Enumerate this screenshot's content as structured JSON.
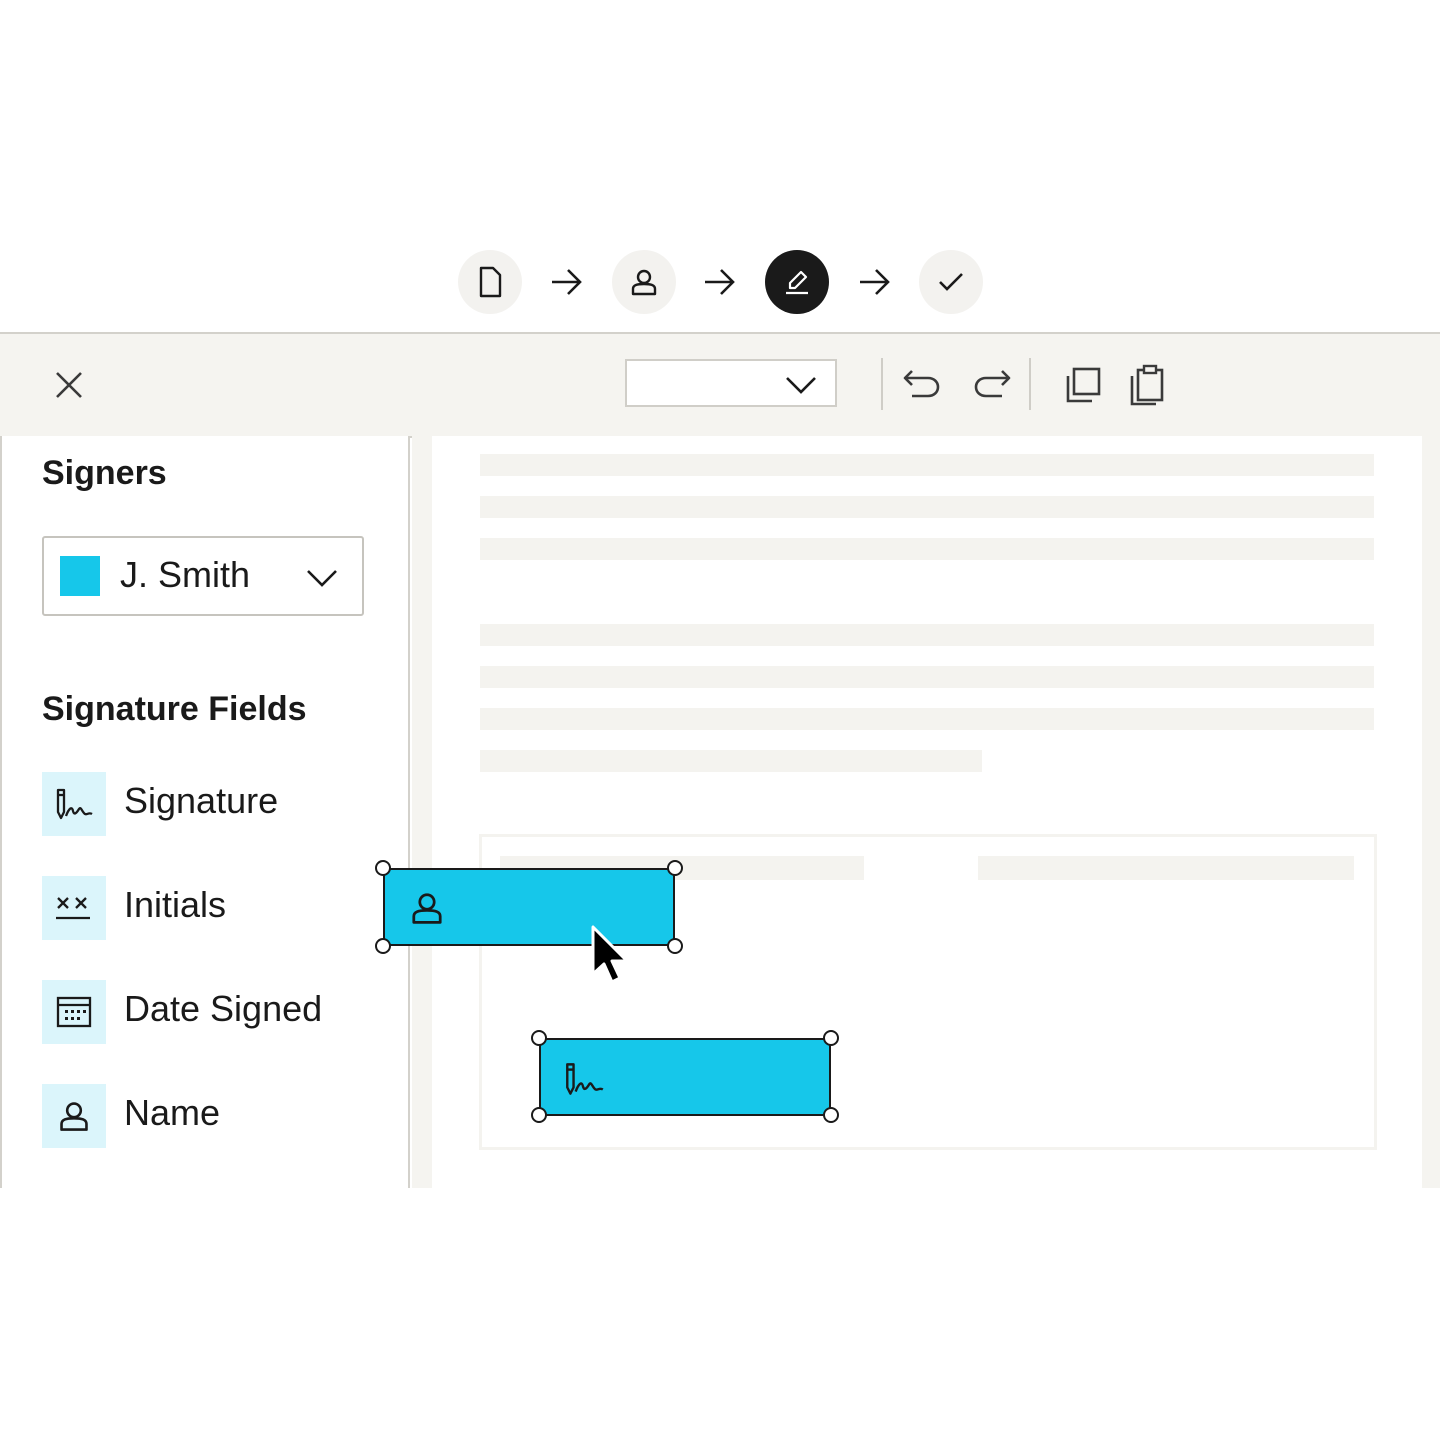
{
  "steps": [
    {
      "name": "document",
      "icon": "document-icon",
      "active": false
    },
    {
      "name": "recipients",
      "icon": "person-icon",
      "active": false
    },
    {
      "name": "fields",
      "icon": "pen-icon",
      "active": true
    },
    {
      "name": "review",
      "icon": "checkmark-icon",
      "active": false
    }
  ],
  "toolbar": {
    "close_icon": "close-icon",
    "zoom_value": "",
    "undo_icon": "undo-icon",
    "redo_icon": "redo-icon",
    "copy_icon": "copy-icon",
    "paste_icon": "paste-icon"
  },
  "sidebar": {
    "signers_heading": "Signers",
    "selected_signer": "J. Smith",
    "signer_color": "#16c7ea",
    "fields_heading": "Signature Fields",
    "fields": [
      {
        "label": "Signature",
        "icon": "signature-icon"
      },
      {
        "label": "Initials",
        "icon": "initials-icon"
      },
      {
        "label": "Date Signed",
        "icon": "calendar-icon"
      },
      {
        "label": "Name",
        "icon": "person-icon"
      }
    ]
  },
  "colors": {
    "field_fill": "#16c7ea",
    "field_icon_bg": "#dbf5fb",
    "toolbar_bg": "#f5f4f0",
    "active_step": "#1a1a1a"
  },
  "placed_fields": [
    {
      "type": "name",
      "icon": "person-icon",
      "selected": true
    },
    {
      "type": "signature",
      "icon": "signature-icon",
      "selected": true
    }
  ]
}
